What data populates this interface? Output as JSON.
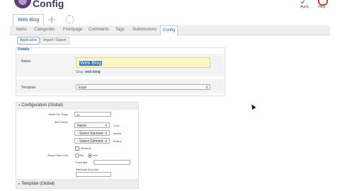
{
  "app": {
    "title": "Config"
  },
  "toolbar": {
    "apply_label": "Apply",
    "help_label": "Help",
    "accent": "#3aa13a",
    "help_color": "#d04030"
  },
  "top_tabs": {
    "active": "Web Blog"
  },
  "subnav": {
    "items": [
      "Items",
      "Categories",
      "Frontpage",
      "Comments",
      "Tags",
      "Submissions",
      "Config"
    ],
    "active": "Config"
  },
  "section_tabs": {
    "application": "Application",
    "import_export": "Import / Export"
  },
  "details": {
    "title": "Details",
    "name_label": "Name",
    "name_value": "Web Blog",
    "slug_label": "Slug:",
    "slug_value": "web-blog",
    "template_label": "Template",
    "template_value": "Expo"
  },
  "config": {
    "title": "Configuration (Global)",
    "items_per_page_label": "Items Per Page",
    "items_per_page_value": "25",
    "item_order_label": "Item Order",
    "order_1_value": "Name",
    "order_1_suffix": "Core",
    "order_2_value": "- Select Element -",
    "order_2_suffix": "Article",
    "order_3_value": "- Select Element -",
    "order_3_suffix": "Author",
    "reverse_label": "Reverse",
    "show_feed_label": "Show Feed Link",
    "feed_no": "No",
    "feed_yes": "Yes",
    "feed_title_label": "Feed title",
    "alt_feed_label": "Alternate feed link"
  },
  "template_section": {
    "title": "Template (Global)"
  }
}
